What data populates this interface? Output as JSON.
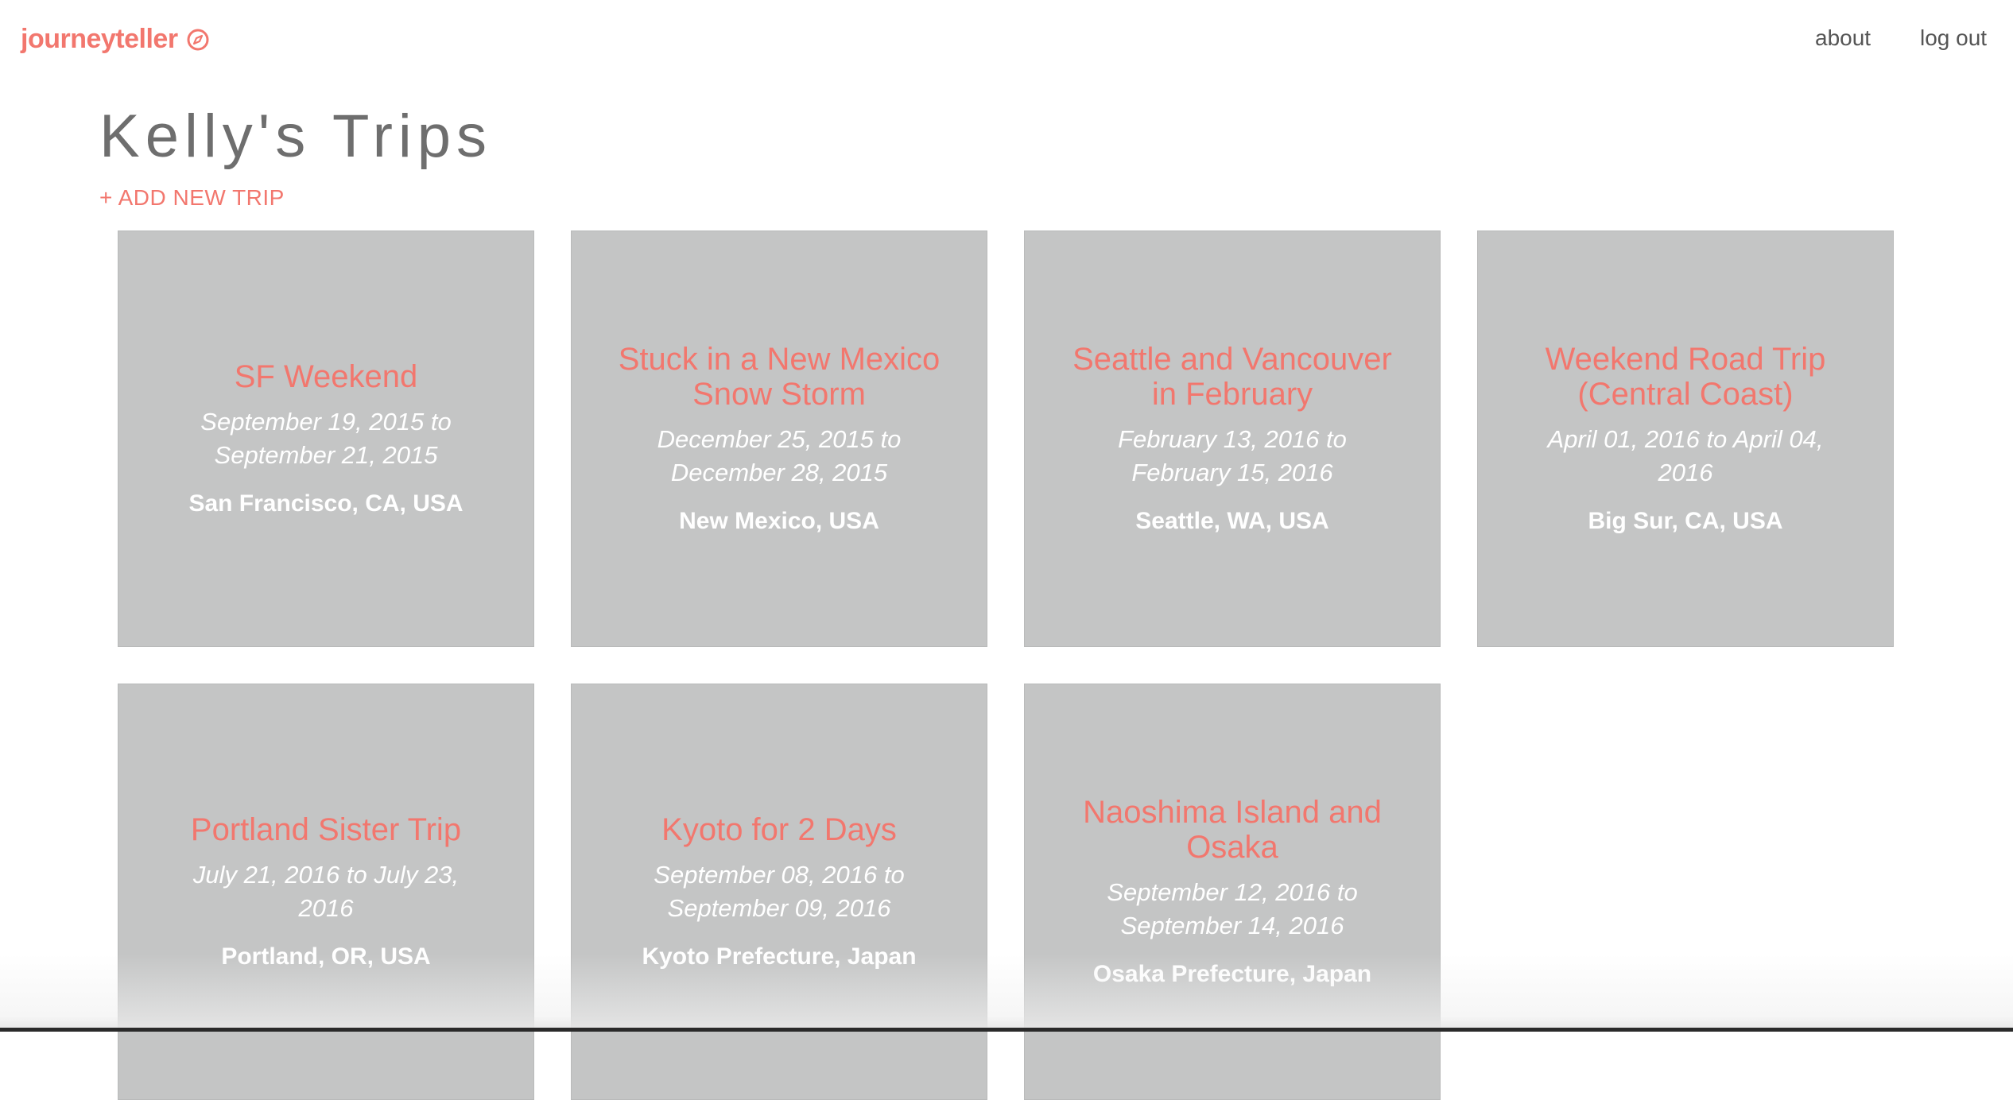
{
  "header": {
    "brand": "journeyteller",
    "brand_icon": "compass-icon",
    "nav": {
      "about": "about",
      "logout": "log out"
    },
    "accent_color": "#f2776e"
  },
  "main": {
    "title": "Kelly's Trips",
    "add_trip_label": "+ ADD NEW TRIP",
    "trips": [
      {
        "title": "SF Weekend",
        "dates": "September 19, 2015 to September 21, 2015",
        "location": "San Francisco, CA, USA"
      },
      {
        "title": "Stuck in a New Mexico Snow Storm",
        "dates": "December 25, 2015 to December 28, 2015",
        "location": "New Mexico, USA"
      },
      {
        "title": "Seattle and Vancouver in February",
        "dates": "February 13, 2016 to February 15, 2016",
        "location": "Seattle, WA, USA"
      },
      {
        "title": "Weekend Road Trip (Central Coast)",
        "dates": "April 01, 2016 to April 04, 2016",
        "location": "Big Sur, CA, USA"
      },
      {
        "title": "Portland Sister Trip",
        "dates": "July 21, 2016 to July 23, 2016",
        "location": "Portland, OR, USA"
      },
      {
        "title": "Kyoto for 2 Days",
        "dates": "September 08, 2016 to September 09, 2016",
        "location": "Kyoto Prefecture, Japan"
      },
      {
        "title": "Naoshima Island and Osaka",
        "dates": "September 12, 2016 to September 14, 2016",
        "location": "Osaka Prefecture, Japan"
      }
    ]
  }
}
